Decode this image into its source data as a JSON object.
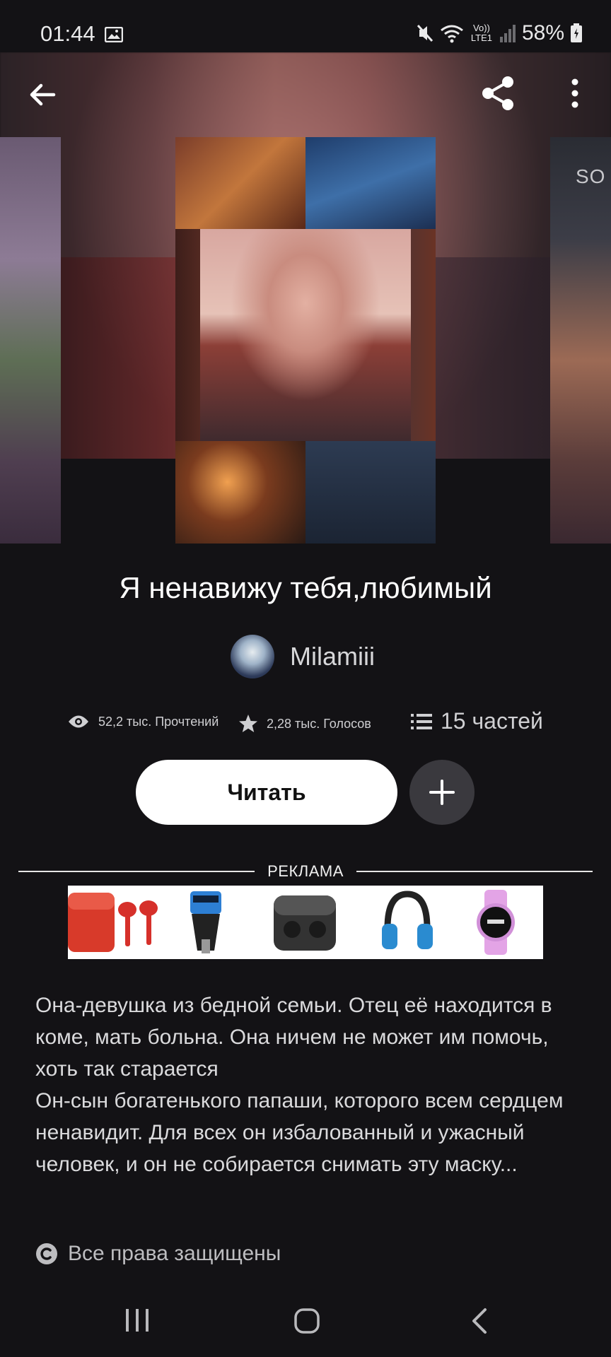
{
  "status_bar": {
    "time": "01:44",
    "volte": "Vo)) LTE1",
    "battery": "58%"
  },
  "hero": {
    "right_cover_text": "SO"
  },
  "story": {
    "title": "Я ненавижу тебя,любимый",
    "author": "Milamiii",
    "reads": "52,2 тыс. Прочтений",
    "votes": "2,28 тыс. Голосов",
    "parts": "15 частей",
    "read_button": "Читать",
    "description": "Она-девушка из бедной семьи. Отец её находится в коме, мать больна. Она ничем не может им помочь, хоть так старается\nОн-сын богатенького папаши, которого всем сердцем ненавидит. Для всех он избалованный и ужасный человек, и он не собирается снимать эту маску...",
    "rights": "Все права защищены"
  },
  "ad": {
    "label": "РЕКЛАМА"
  },
  "colors": {
    "background": "#131215",
    "button_light": "#ffffff",
    "button_dark": "#3a393e"
  }
}
